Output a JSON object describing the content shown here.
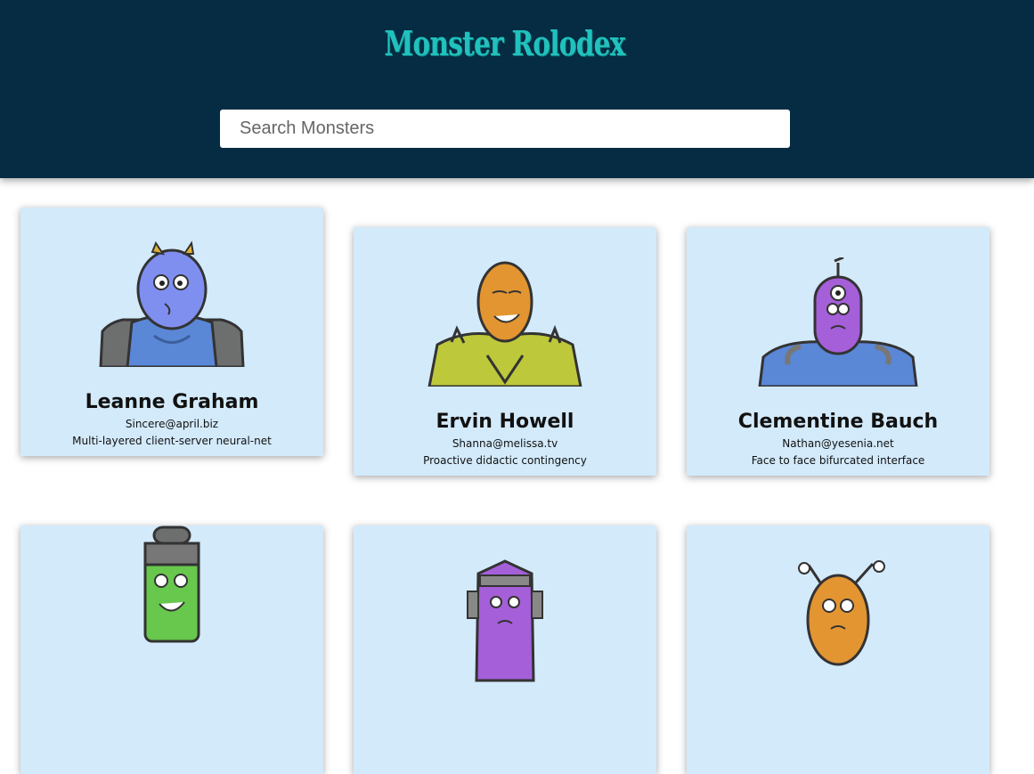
{
  "app": {
    "title": "Monster Rolodex"
  },
  "search": {
    "placeholder": "Search Monsters"
  },
  "cards": [
    {
      "name": "Leanne Graham",
      "email": "Sincere@april.biz",
      "phrase": "Multi-layered client-server neural-net"
    },
    {
      "name": "Ervin Howell",
      "email": "Shanna@melissa.tv",
      "phrase": "Proactive didactic contingency"
    },
    {
      "name": "Clementine Bauch",
      "email": "Nathan@yesenia.net",
      "phrase": "Face to face bifurcated interface"
    },
    {
      "name": "",
      "email": "",
      "phrase": ""
    },
    {
      "name": "",
      "email": "",
      "phrase": ""
    },
    {
      "name": "",
      "email": "",
      "phrase": ""
    }
  ],
  "colors": {
    "header_bg": "#052c42",
    "title": "#21c1bd",
    "card_bg": "#d3eafb"
  }
}
